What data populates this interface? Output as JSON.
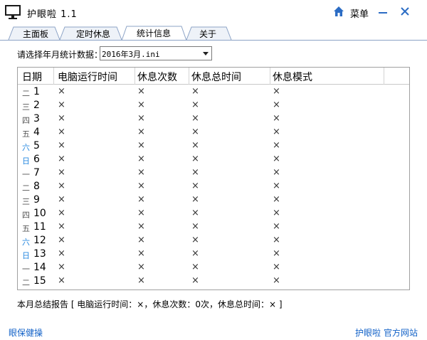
{
  "titlebar": {
    "app_name": "护眼啦 1.1",
    "menu_label": "菜单",
    "minimize_symbol": "—",
    "close_symbol": "✕"
  },
  "tabs": [
    {
      "label": "主面板",
      "active": false
    },
    {
      "label": "定时休息",
      "active": false
    },
    {
      "label": "统计信息",
      "active": true
    },
    {
      "label": "关于",
      "active": false
    }
  ],
  "stats": {
    "select_label": "请选择年月统计数据：",
    "select_value": "2016年3月.ini",
    "columns": [
      "日期",
      "电脑运行时间",
      "休息次数",
      "休息总时间",
      "休息模式"
    ],
    "rows": [
      {
        "wd": "二",
        "day": "1",
        "weekend": false,
        "c1": "×",
        "c2": "×",
        "c3": "×",
        "c4": "×"
      },
      {
        "wd": "三",
        "day": "2",
        "weekend": false,
        "c1": "×",
        "c2": "×",
        "c3": "×",
        "c4": "×"
      },
      {
        "wd": "四",
        "day": "3",
        "weekend": false,
        "c1": "×",
        "c2": "×",
        "c3": "×",
        "c4": "×"
      },
      {
        "wd": "五",
        "day": "4",
        "weekend": false,
        "c1": "×",
        "c2": "×",
        "c3": "×",
        "c4": "×"
      },
      {
        "wd": "六",
        "day": "5",
        "weekend": true,
        "c1": "×",
        "c2": "×",
        "c3": "×",
        "c4": "×"
      },
      {
        "wd": "日",
        "day": "6",
        "weekend": true,
        "c1": "×",
        "c2": "×",
        "c3": "×",
        "c4": "×"
      },
      {
        "wd": "一",
        "day": "7",
        "weekend": false,
        "c1": "×",
        "c2": "×",
        "c3": "×",
        "c4": "×"
      },
      {
        "wd": "二",
        "day": "8",
        "weekend": false,
        "c1": "×",
        "c2": "×",
        "c3": "×",
        "c4": "×"
      },
      {
        "wd": "三",
        "day": "9",
        "weekend": false,
        "c1": "×",
        "c2": "×",
        "c3": "×",
        "c4": "×"
      },
      {
        "wd": "四",
        "day": "10",
        "weekend": false,
        "c1": "×",
        "c2": "×",
        "c3": "×",
        "c4": "×"
      },
      {
        "wd": "五",
        "day": "11",
        "weekend": false,
        "c1": "×",
        "c2": "×",
        "c3": "×",
        "c4": "×"
      },
      {
        "wd": "六",
        "day": "12",
        "weekend": true,
        "c1": "×",
        "c2": "×",
        "c3": "×",
        "c4": "×"
      },
      {
        "wd": "日",
        "day": "13",
        "weekend": true,
        "c1": "×",
        "c2": "×",
        "c3": "×",
        "c4": "×"
      },
      {
        "wd": "一",
        "day": "14",
        "weekend": false,
        "c1": "×",
        "c2": "×",
        "c3": "×",
        "c4": "×"
      },
      {
        "wd": "二",
        "day": "15",
        "weekend": false,
        "c1": "×",
        "c2": "×",
        "c3": "×",
        "c4": "×"
      }
    ],
    "summary": "本月总结报告 [ 电脑运行时间：×，休息次数：0次，休息总时间：× ]"
  },
  "footer": {
    "left_link": "眼保健操",
    "right_link_1": "护眼啦",
    "right_link_2": "官方网站"
  },
  "colors": {
    "accent": "#1463c8",
    "weekend": "#2a8ae0",
    "tab_border": "#8ca3c6"
  }
}
